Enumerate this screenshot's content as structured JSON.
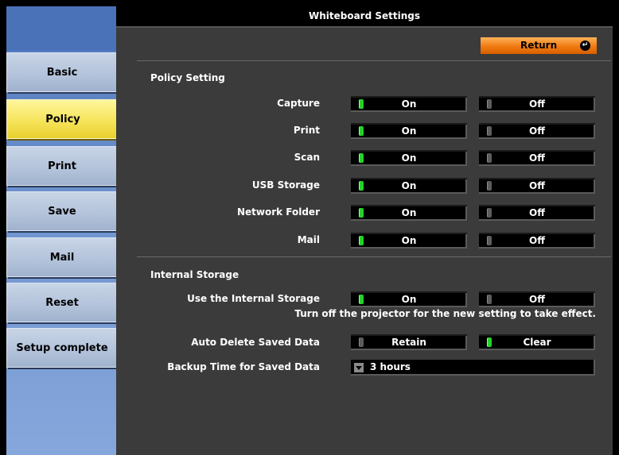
{
  "window": {
    "title": "Whiteboard Settings"
  },
  "sidebar": {
    "items": [
      {
        "label": "Basic"
      },
      {
        "label": "Policy",
        "active": true
      },
      {
        "label": "Print"
      },
      {
        "label": "Save"
      },
      {
        "label": "Mail"
      },
      {
        "label": "Reset"
      },
      {
        "label": "Setup complete"
      }
    ]
  },
  "header": {
    "return_label": "Return",
    "return_icon": "enter-arrow-icon"
  },
  "policy": {
    "title": "Policy Setting",
    "rows": [
      {
        "label": "Capture",
        "on": "On",
        "off": "Off",
        "selected": "on"
      },
      {
        "label": "Print",
        "on": "On",
        "off": "Off",
        "selected": "on"
      },
      {
        "label": "Scan",
        "on": "On",
        "off": "Off",
        "selected": "on"
      },
      {
        "label": "USB Storage",
        "on": "On",
        "off": "Off",
        "selected": "on"
      },
      {
        "label": "Network Folder",
        "on": "On",
        "off": "Off",
        "selected": "on"
      },
      {
        "label": "Mail",
        "on": "On",
        "off": "Off",
        "selected": "on"
      }
    ]
  },
  "storage": {
    "title": "Internal Storage",
    "use_internal": {
      "label": "Use the Internal Storage",
      "on": "On",
      "off": "Off",
      "selected": "on"
    },
    "note": "Turn off the projector for the new setting to take effect.",
    "auto_delete": {
      "label": "Auto Delete Saved Data",
      "retain": "Retain",
      "clear": "Clear",
      "selected": "clear"
    },
    "backup_time": {
      "label": "Backup Time for Saved Data",
      "value": "3 hours"
    }
  },
  "colors": {
    "indicator_on": "#25d22a",
    "return_button": "#f07a10",
    "active_tab": "#f6e45a"
  }
}
